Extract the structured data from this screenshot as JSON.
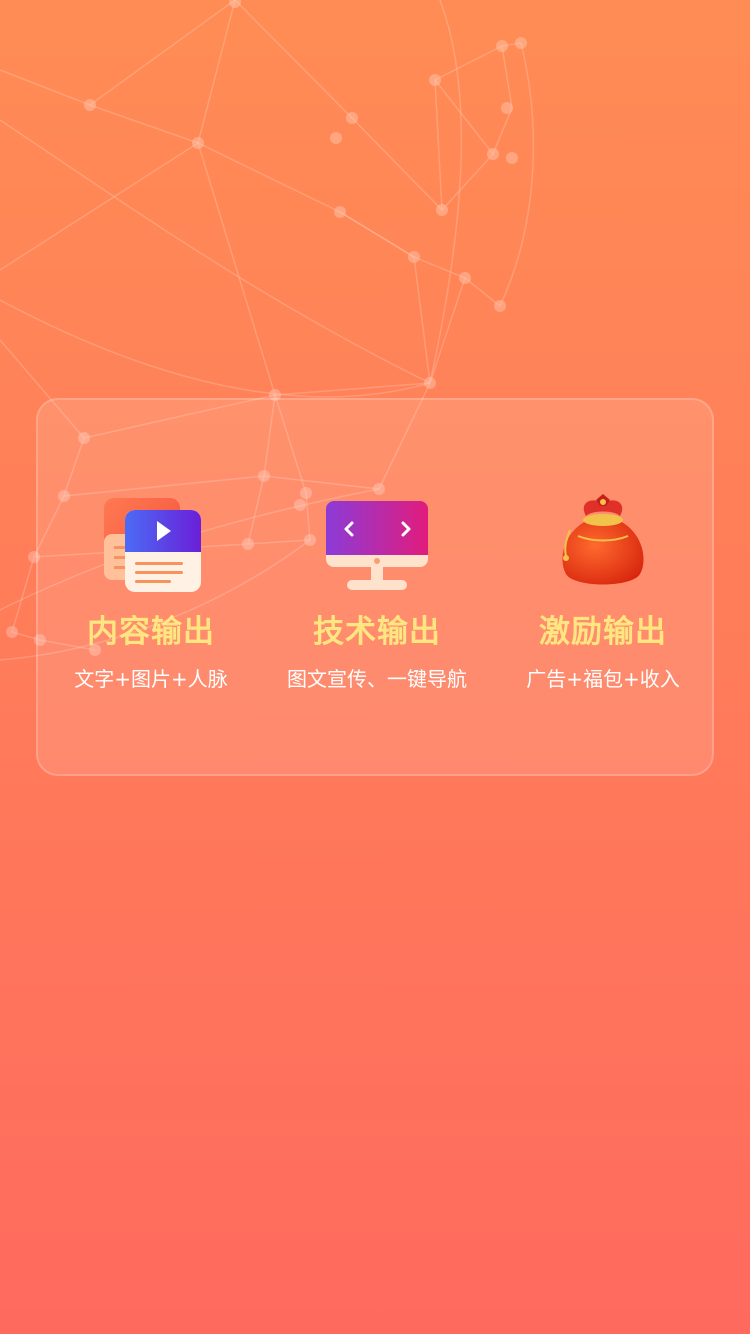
{
  "features": [
    {
      "title": "内容输出",
      "subtitle": "文字+图片+人脉",
      "icon": "video-document-icon"
    },
    {
      "title": "技术输出",
      "subtitle": "图文宣传、一键导航",
      "icon": "monitor-icon"
    },
    {
      "title": "激励输出",
      "subtitle": "广告+福包+收入",
      "icon": "lucky-bag-icon"
    }
  ],
  "colors": {
    "background_top": "#FF8C55",
    "background_bottom": "#FF6A5E",
    "title": "#FFE680",
    "subtitle": "#FFFFFF"
  }
}
